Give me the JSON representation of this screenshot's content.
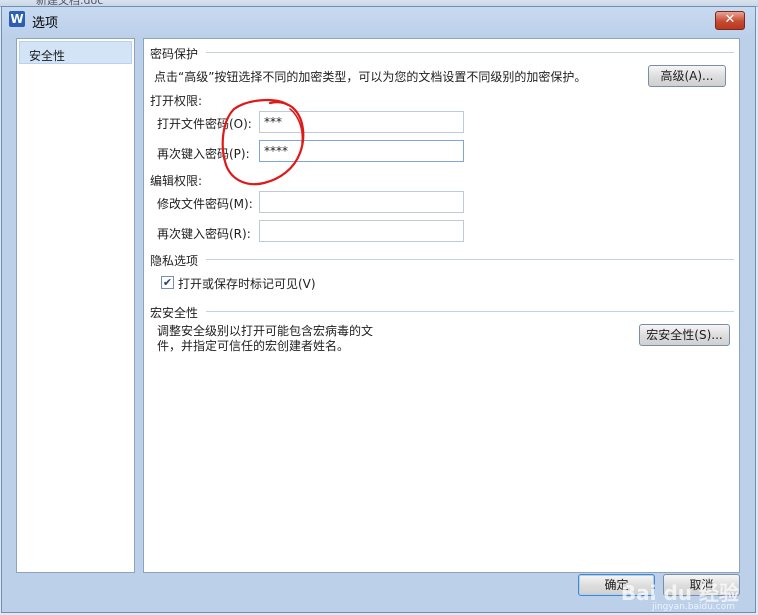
{
  "background_window": {
    "title_fragment": "新建文档.doc"
  },
  "dialog": {
    "title": "选项",
    "app_icon_letter": "W",
    "close_label": "✕"
  },
  "sidebar": {
    "items": [
      {
        "label": "安全性",
        "selected": true
      }
    ]
  },
  "password_section": {
    "title": "密码保护",
    "description": "点击“高级”按钮选择不同的加密类型，可以为您的文档设置不同级别的加密保护。",
    "advanced_button": "高级(A)..."
  },
  "open_permission": {
    "title": "打开权限:",
    "password_label": "打开文件密码(O):",
    "password_value": "***",
    "confirm_label": "再次键入密码(P):",
    "confirm_value": "****"
  },
  "edit_permission": {
    "title": "编辑权限:",
    "password_label": "修改文件密码(M):",
    "password_value": "",
    "confirm_label": "再次键入密码(R):",
    "confirm_value": ""
  },
  "privacy": {
    "title": "隐私选项",
    "checkbox_label": "打开或保存时标记可见(V)",
    "checked": true
  },
  "macro": {
    "title": "宏安全性",
    "description_line1": "调整安全级别以打开可能包含宏病毒的文",
    "description_line2": "件，并指定可信任的宏创建者姓名。",
    "button": "宏安全性(S)..."
  },
  "footer": {
    "ok_label": "确定",
    "cancel_label": "取消"
  },
  "watermark": {
    "text": "Bai du 经验",
    "url": "jingyan.baidu.com"
  },
  "colors": {
    "annotation_circle": "#e01818",
    "selected_item": "#d3e4f7",
    "accent_blue": "#4a86c5"
  }
}
